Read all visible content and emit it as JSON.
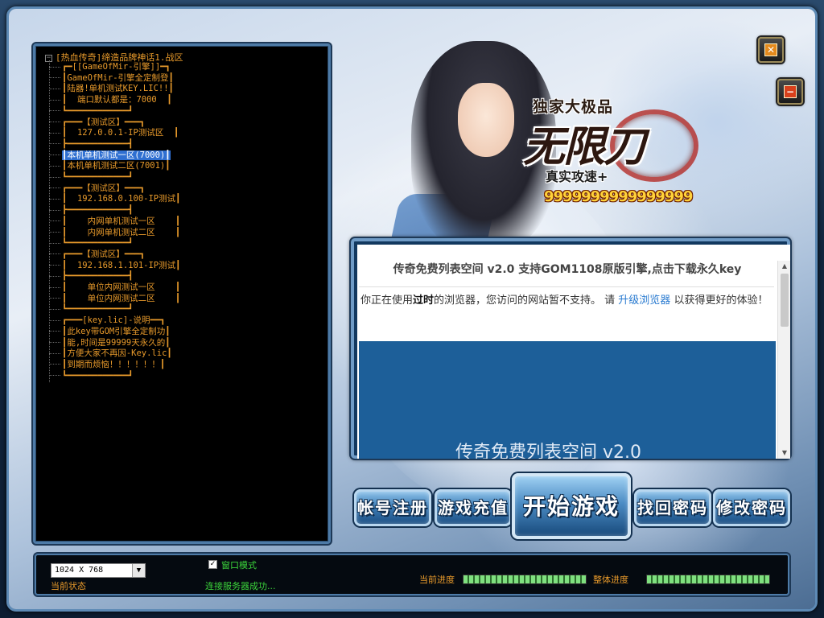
{
  "tree": {
    "root_label": "[热血传奇]缔造品牌神话1.战区",
    "items": [
      {
        "text": "┏━[[GameOfMir-引擎]]━┓",
        "selected": false
      },
      {
        "text": "┃GameOfMir-引擎全定制登┃",
        "selected": false
      },
      {
        "text": "┃陆器!单机测试KEY.LIC!!┃",
        "selected": false
      },
      {
        "text": "┃  端口默认都是：7000  ┃",
        "selected": false
      },
      {
        "text": "┗━━━━━━━━━━━━┛",
        "selected": false
      },
      {
        "text": "┏━━━【测试区】━━━┓",
        "selected": false
      },
      {
        "text": "┃  127.0.0.1-IP测试区  ┃",
        "selected": false
      },
      {
        "text": "┣━━━━━━━━━━━━┫",
        "selected": false
      },
      {
        "text": "┃本机单机测试一区(7000)┃",
        "selected": true
      },
      {
        "text": "┃本机单机测试二区(7001)┃",
        "selected": false
      },
      {
        "text": "┗━━━━━━━━━━━━┛",
        "selected": false
      },
      {
        "text": "┏━━━【测试区】━━━┓",
        "selected": false
      },
      {
        "text": "┃  192.168.0.100-IP测试┃",
        "selected": false
      },
      {
        "text": "┣━━━━━━━━━━━━┫",
        "selected": false
      },
      {
        "text": "┃    内网单机测试一区    ┃",
        "selected": false
      },
      {
        "text": "┃    内网单机测试二区    ┃",
        "selected": false
      },
      {
        "text": "┗━━━━━━━━━━━━┛",
        "selected": false
      },
      {
        "text": "┏━━━【测试区】━━━┓",
        "selected": false
      },
      {
        "text": "┃  192.168.1.101-IP测试┃",
        "selected": false
      },
      {
        "text": "┣━━━━━━━━━━━━┫",
        "selected": false
      },
      {
        "text": "┃    单位内网测试一区    ┃",
        "selected": false
      },
      {
        "text": "┃    单位内网测试二区    ┃",
        "selected": false
      },
      {
        "text": "┗━━━━━━━━━━━━┛",
        "selected": false
      },
      {
        "text": "┏━━━[key.lic]-说明━━┓",
        "selected": false
      },
      {
        "text": "┃此key带GOM引擎全定制功┃",
        "selected": false
      },
      {
        "text": "┃能,时间是99999天永久的┃",
        "selected": false
      },
      {
        "text": "┃方便大家不再因-Key.lic┃",
        "selected": false
      },
      {
        "text": "┃到期而烦恼！！！！！！┃",
        "selected": false
      },
      {
        "text": "┗━━━━━━━━━━━━┛",
        "selected": false
      }
    ]
  },
  "logo": {
    "subtitle": "独家大极品",
    "title": "无限刀",
    "tagline": "真实攻速+",
    "nines": "9999999999999999"
  },
  "window": {
    "close_glyph": "✕",
    "minimize_glyph": "−"
  },
  "browser": {
    "title": "传奇免费列表空间 v2.0 支持GOM1108原版引擎,点击下载永久key",
    "msg_before": "你正在使用",
    "msg_bold": "过时",
    "msg_mid": "的浏览器，您访问的网站暂不支持。 请 ",
    "msg_link": "升级浏览器",
    "msg_after": " 以获得更好的体验！",
    "banner_text": "传奇免费列表空间 v2.0"
  },
  "buttons": {
    "register": "帐号注册",
    "recharge": "游戏充值",
    "start": "开始游戏",
    "recover": "找回密码",
    "change_pwd": "修改密码"
  },
  "status": {
    "resolution": "1024 X 768",
    "current_status_label": "当前状态",
    "window_mode_label": "窗口模式",
    "window_mode_checked": true,
    "connection_message": "连接服务器成功...",
    "current_progress_label": "当前进度",
    "overall_progress_label": "整体进度",
    "current_progress": 1.0,
    "overall_progress": 1.0
  },
  "colors": {
    "tree_text": "#e89a2b",
    "status_green": "#3bd43b",
    "selection_blue": "#2f6fd1",
    "banner_blue": "#1d5f99"
  }
}
